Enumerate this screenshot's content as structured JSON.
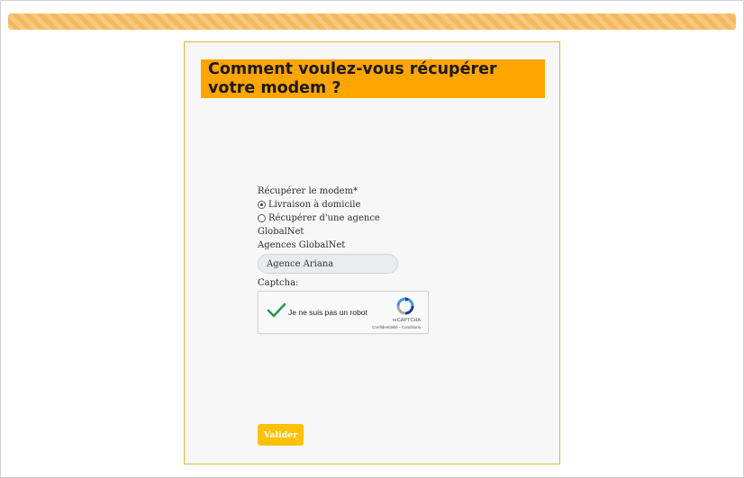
{
  "progress": {
    "fill_percent": 100,
    "color": "#f5b85c"
  },
  "header": {
    "title": "Comment voulez-vous récupérer votre modem ?"
  },
  "form": {
    "field_label": "Récupérer le modem*",
    "options": [
      {
        "label": "Livraison à domicile",
        "checked": true
      },
      {
        "label": "Récupérer d'une agence",
        "checked": false
      }
    ],
    "option_continuation": "GlobalNet",
    "agency_label": "Agences GlobalNet",
    "agency_selected": "Agence Ariana",
    "captcha_label": "Captcha:"
  },
  "recaptcha": {
    "checkbox_label": "Je ne suis pas un robot",
    "brand": "reCAPTCHA",
    "links": "Confidentialité - Conditions",
    "check_color": "#1e9c4e"
  },
  "submit": {
    "label": "Valider",
    "color": "#ffc107"
  },
  "colors": {
    "panel_border": "#e2b53a",
    "title_bg": "#ffa500",
    "panel_bg": "#f7f7f7"
  }
}
